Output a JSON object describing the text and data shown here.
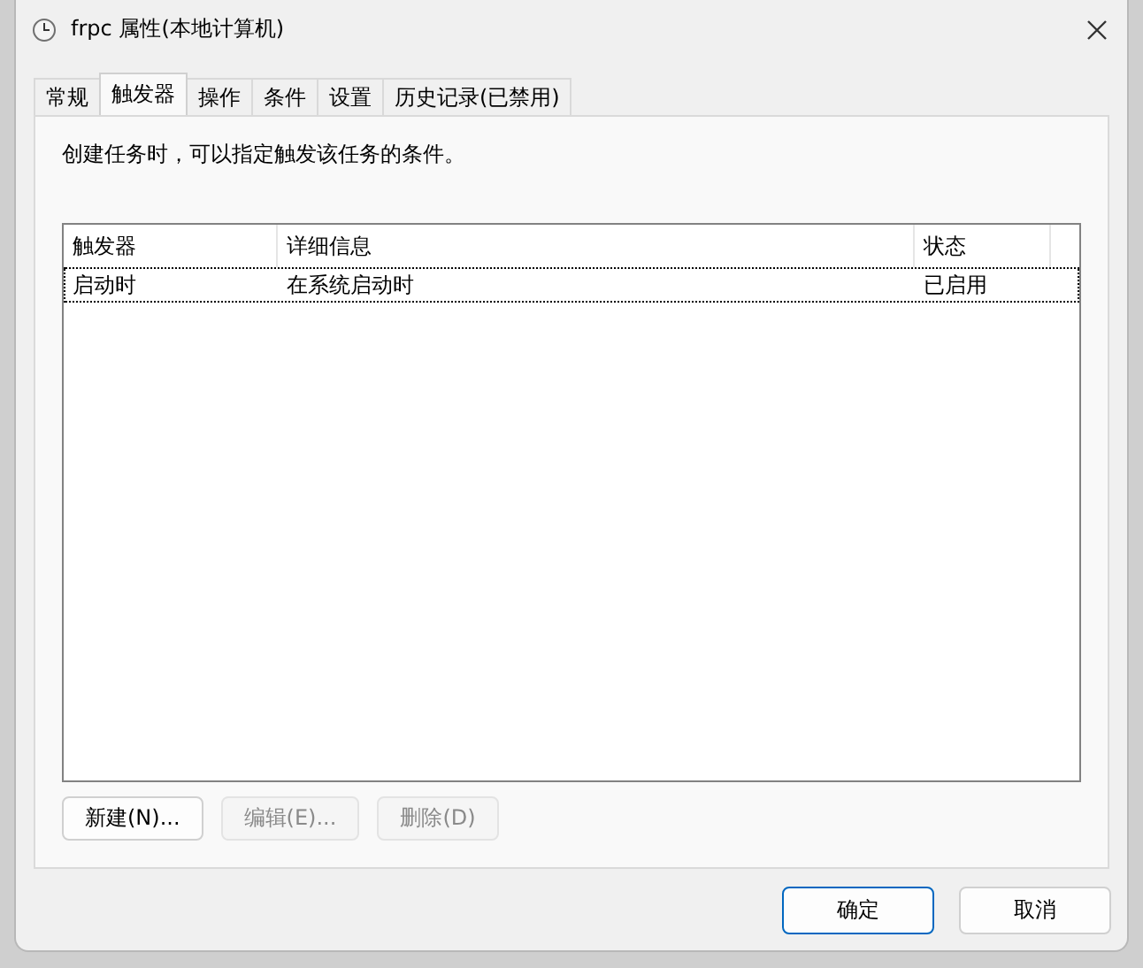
{
  "window": {
    "title": "frpc 属性(本地计算机)"
  },
  "tabs": [
    {
      "label": "常规",
      "selected": false
    },
    {
      "label": "触发器",
      "selected": true
    },
    {
      "label": "操作",
      "selected": false
    },
    {
      "label": "条件",
      "selected": false
    },
    {
      "label": "设置",
      "selected": false
    },
    {
      "label": "历史记录(已禁用)",
      "selected": false
    }
  ],
  "description": "创建任务时，可以指定触发该任务的条件。",
  "table": {
    "columns": [
      "触发器",
      "详细信息",
      "状态"
    ],
    "rows": [
      {
        "cells": [
          "启动时",
          "在系统启动时",
          "已启用"
        ],
        "selected": true
      }
    ]
  },
  "list_buttons": [
    {
      "label": "新建(N)...",
      "disabled": false
    },
    {
      "label": "编辑(E)...",
      "disabled": true
    },
    {
      "label": "删除(D)",
      "disabled": true
    }
  ],
  "dialog_buttons": [
    {
      "label": "确定",
      "default": true
    },
    {
      "label": "取消",
      "default": false
    }
  ]
}
